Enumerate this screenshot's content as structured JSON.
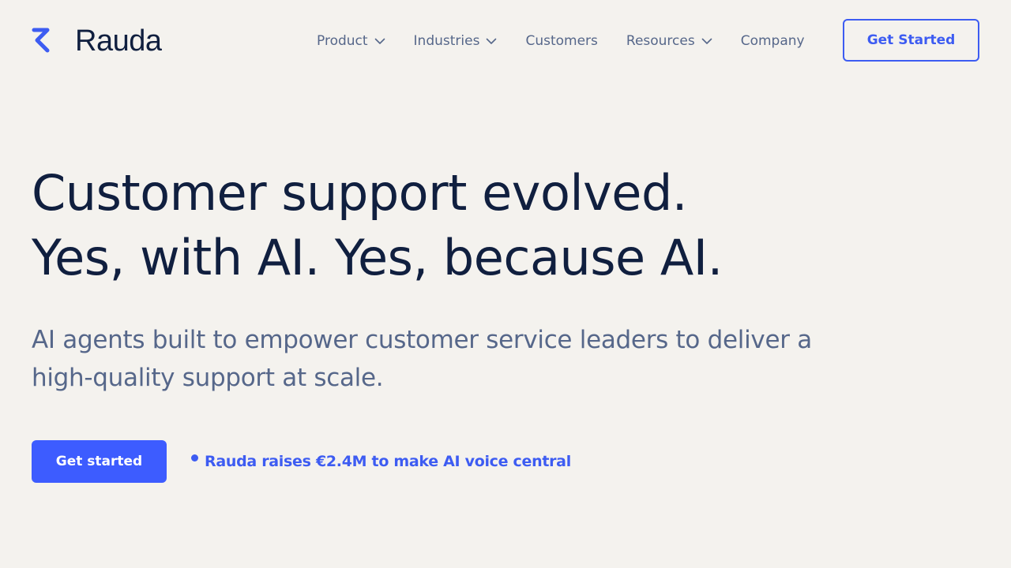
{
  "brand": {
    "name": "Rauda",
    "logo_icon": "rauda-logo-mark",
    "accent_color": "#3d5cf2",
    "text_color": "#101f3f",
    "muted_color": "#56678a",
    "background": "#f4f2ee"
  },
  "nav": {
    "items": [
      {
        "label": "Product",
        "has_dropdown": true
      },
      {
        "label": "Industries",
        "has_dropdown": true
      },
      {
        "label": "Customers",
        "has_dropdown": false
      },
      {
        "label": "Resources",
        "has_dropdown": true
      },
      {
        "label": "Company",
        "has_dropdown": false
      }
    ],
    "cta_label": "Get Started",
    "dropdown_icon": "chevron-down-icon"
  },
  "hero": {
    "title_line1": "Customer support evolved.",
    "title_line2": "Yes, with AI. Yes, because AI.",
    "subtitle": "AI agents built to empower customer service leaders to deliver a high-quality support at scale.",
    "primary_cta": "Get started",
    "news_link": "Rauda raises €2.4M to make AI voice central"
  }
}
